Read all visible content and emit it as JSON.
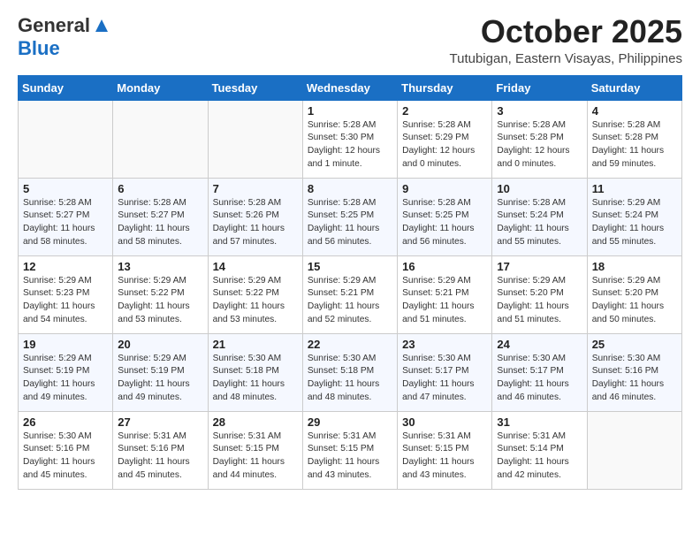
{
  "header": {
    "logo_general": "General",
    "logo_blue": "Blue",
    "month_title": "October 2025",
    "location": "Tutubigan, Eastern Visayas, Philippines"
  },
  "weekdays": [
    "Sunday",
    "Monday",
    "Tuesday",
    "Wednesday",
    "Thursday",
    "Friday",
    "Saturday"
  ],
  "weeks": [
    [
      {
        "day": "",
        "content": ""
      },
      {
        "day": "",
        "content": ""
      },
      {
        "day": "",
        "content": ""
      },
      {
        "day": "1",
        "content": "Sunrise: 5:28 AM\nSunset: 5:30 PM\nDaylight: 12 hours\nand 1 minute."
      },
      {
        "day": "2",
        "content": "Sunrise: 5:28 AM\nSunset: 5:29 PM\nDaylight: 12 hours\nand 0 minutes."
      },
      {
        "day": "3",
        "content": "Sunrise: 5:28 AM\nSunset: 5:28 PM\nDaylight: 12 hours\nand 0 minutes."
      },
      {
        "day": "4",
        "content": "Sunrise: 5:28 AM\nSunset: 5:28 PM\nDaylight: 11 hours\nand 59 minutes."
      }
    ],
    [
      {
        "day": "5",
        "content": "Sunrise: 5:28 AM\nSunset: 5:27 PM\nDaylight: 11 hours\nand 58 minutes."
      },
      {
        "day": "6",
        "content": "Sunrise: 5:28 AM\nSunset: 5:27 PM\nDaylight: 11 hours\nand 58 minutes."
      },
      {
        "day": "7",
        "content": "Sunrise: 5:28 AM\nSunset: 5:26 PM\nDaylight: 11 hours\nand 57 minutes."
      },
      {
        "day": "8",
        "content": "Sunrise: 5:28 AM\nSunset: 5:25 PM\nDaylight: 11 hours\nand 56 minutes."
      },
      {
        "day": "9",
        "content": "Sunrise: 5:28 AM\nSunset: 5:25 PM\nDaylight: 11 hours\nand 56 minutes."
      },
      {
        "day": "10",
        "content": "Sunrise: 5:28 AM\nSunset: 5:24 PM\nDaylight: 11 hours\nand 55 minutes."
      },
      {
        "day": "11",
        "content": "Sunrise: 5:29 AM\nSunset: 5:24 PM\nDaylight: 11 hours\nand 55 minutes."
      }
    ],
    [
      {
        "day": "12",
        "content": "Sunrise: 5:29 AM\nSunset: 5:23 PM\nDaylight: 11 hours\nand 54 minutes."
      },
      {
        "day": "13",
        "content": "Sunrise: 5:29 AM\nSunset: 5:22 PM\nDaylight: 11 hours\nand 53 minutes."
      },
      {
        "day": "14",
        "content": "Sunrise: 5:29 AM\nSunset: 5:22 PM\nDaylight: 11 hours\nand 53 minutes."
      },
      {
        "day": "15",
        "content": "Sunrise: 5:29 AM\nSunset: 5:21 PM\nDaylight: 11 hours\nand 52 minutes."
      },
      {
        "day": "16",
        "content": "Sunrise: 5:29 AM\nSunset: 5:21 PM\nDaylight: 11 hours\nand 51 minutes."
      },
      {
        "day": "17",
        "content": "Sunrise: 5:29 AM\nSunset: 5:20 PM\nDaylight: 11 hours\nand 51 minutes."
      },
      {
        "day": "18",
        "content": "Sunrise: 5:29 AM\nSunset: 5:20 PM\nDaylight: 11 hours\nand 50 minutes."
      }
    ],
    [
      {
        "day": "19",
        "content": "Sunrise: 5:29 AM\nSunset: 5:19 PM\nDaylight: 11 hours\nand 49 minutes."
      },
      {
        "day": "20",
        "content": "Sunrise: 5:29 AM\nSunset: 5:19 PM\nDaylight: 11 hours\nand 49 minutes."
      },
      {
        "day": "21",
        "content": "Sunrise: 5:30 AM\nSunset: 5:18 PM\nDaylight: 11 hours\nand 48 minutes."
      },
      {
        "day": "22",
        "content": "Sunrise: 5:30 AM\nSunset: 5:18 PM\nDaylight: 11 hours\nand 48 minutes."
      },
      {
        "day": "23",
        "content": "Sunrise: 5:30 AM\nSunset: 5:17 PM\nDaylight: 11 hours\nand 47 minutes."
      },
      {
        "day": "24",
        "content": "Sunrise: 5:30 AM\nSunset: 5:17 PM\nDaylight: 11 hours\nand 46 minutes."
      },
      {
        "day": "25",
        "content": "Sunrise: 5:30 AM\nSunset: 5:16 PM\nDaylight: 11 hours\nand 46 minutes."
      }
    ],
    [
      {
        "day": "26",
        "content": "Sunrise: 5:30 AM\nSunset: 5:16 PM\nDaylight: 11 hours\nand 45 minutes."
      },
      {
        "day": "27",
        "content": "Sunrise: 5:31 AM\nSunset: 5:16 PM\nDaylight: 11 hours\nand 45 minutes."
      },
      {
        "day": "28",
        "content": "Sunrise: 5:31 AM\nSunset: 5:15 PM\nDaylight: 11 hours\nand 44 minutes."
      },
      {
        "day": "29",
        "content": "Sunrise: 5:31 AM\nSunset: 5:15 PM\nDaylight: 11 hours\nand 43 minutes."
      },
      {
        "day": "30",
        "content": "Sunrise: 5:31 AM\nSunset: 5:15 PM\nDaylight: 11 hours\nand 43 minutes."
      },
      {
        "day": "31",
        "content": "Sunrise: 5:31 AM\nSunset: 5:14 PM\nDaylight: 11 hours\nand 42 minutes."
      },
      {
        "day": "",
        "content": ""
      }
    ]
  ]
}
